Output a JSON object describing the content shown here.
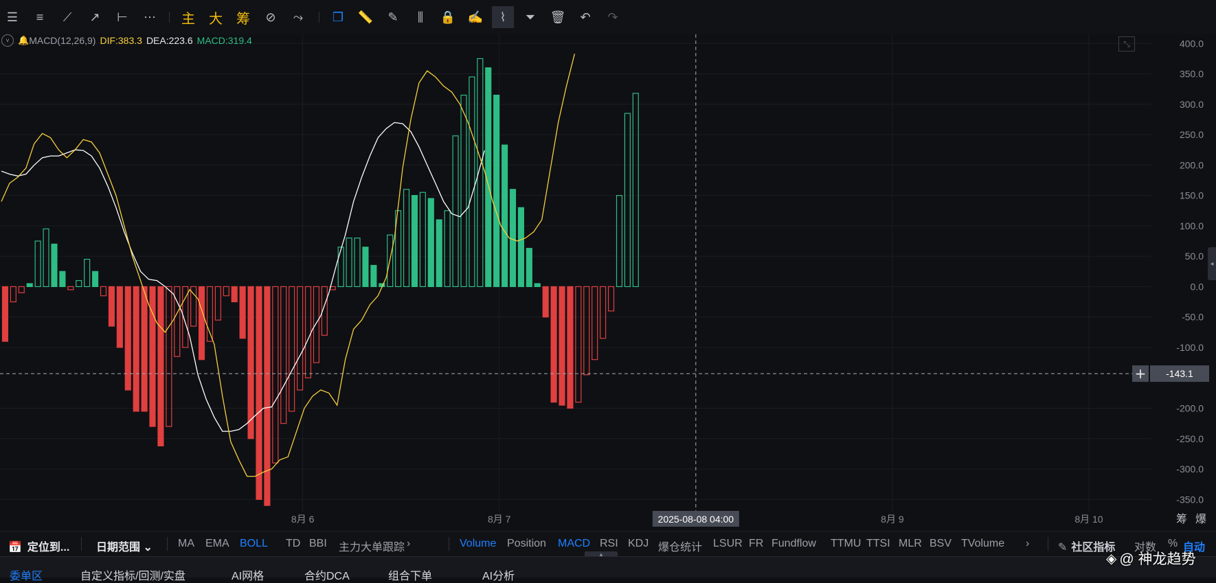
{
  "toolbar": {
    "tools": [
      {
        "icon": "menu-icon",
        "glyph": "☰"
      },
      {
        "icon": "horizontal-lines-icon",
        "glyph": "≡"
      },
      {
        "icon": "trend-line-icon",
        "glyph": "⟋"
      },
      {
        "icon": "ray-line-icon",
        "glyph": "↗"
      },
      {
        "icon": "horizontal-line-icon",
        "glyph": "⊢"
      },
      {
        "icon": "more-tools-icon",
        "glyph": "⋯"
      }
    ],
    "chip_labels": [
      "主",
      "大",
      "筹"
    ],
    "tools2": [
      {
        "icon": "formula-edit-icon",
        "glyph": "⊘"
      },
      {
        "icon": "signal-edit-icon",
        "glyph": "⤳"
      }
    ],
    "tools3": [
      {
        "icon": "copy-layer-icon",
        "glyph": "❐",
        "state": "blue"
      },
      {
        "icon": "ruler-icon",
        "glyph": "📏"
      },
      {
        "icon": "pen-icon",
        "glyph": "✎"
      },
      {
        "icon": "candlestick-icon",
        "glyph": "⫼"
      },
      {
        "icon": "lock-icon",
        "glyph": "🔒"
      },
      {
        "icon": "note-edit-icon",
        "glyph": "✍"
      },
      {
        "icon": "magnet-icon",
        "glyph": "⌇",
        "state": "active"
      },
      {
        "icon": "filter-icon",
        "glyph": "⏷"
      },
      {
        "icon": "trash-icon",
        "glyph": "🗑"
      },
      {
        "icon": "undo-icon",
        "glyph": "↶"
      },
      {
        "icon": "redo-icon",
        "glyph": "↷",
        "state": "dim"
      }
    ]
  },
  "legend": {
    "indicator": "MACD(12,26,9)",
    "dif": "DIF:383.3",
    "dea": "DEA:223.6",
    "macd": "MACD:319.4"
  },
  "crosshair": {
    "price_label": "-143.1",
    "time_label": "2025-08-08 04:00"
  },
  "right_axis_extra": [
    "筹",
    "爆"
  ],
  "colors": {
    "background": "#0f1014",
    "up": "#2ebd85",
    "down": "#e0403f",
    "dif_line": "#f7cf3c",
    "dea_line": "#ffffff",
    "accent": "#1e80ff"
  },
  "chart_data": {
    "type": "bar",
    "title": "MACD(12,26,9)",
    "ylim": [
      -370,
      415
    ],
    "yticks": [
      400,
      350,
      300,
      250,
      200,
      150,
      100,
      50,
      0,
      -50,
      -100,
      -200,
      -250,
      -300,
      -350
    ],
    "ytick_labels": [
      "400.0",
      "350.0",
      "300.0",
      "250.0",
      "200.0",
      "150.0",
      "100.0",
      "50.0",
      "0.0",
      "-50.0",
      "-100.0",
      "-200.0",
      "-250.0",
      "-300.0",
      "-350.0"
    ],
    "x_tick_labels": [
      {
        "label": "8月 6",
        "bar": 36.8
      },
      {
        "label": "8月 7",
        "bar": 60.8
      },
      {
        "label": "8月 9",
        "bar": 108.8
      },
      {
        "label": "8月 10",
        "bar": 132.8
      }
    ],
    "crosshair_bar": 84.8,
    "crosshair_value": -143.1,
    "bar_step_hours": 1,
    "histogram": [
      -90,
      -25,
      -10,
      5,
      75,
      95,
      70,
      25,
      -5,
      10,
      45,
      25,
      -15,
      -65,
      -100,
      -170,
      -205,
      -205,
      -230,
      -262,
      -230,
      -115,
      -100,
      -65,
      -120,
      -90,
      -55,
      -15,
      -25,
      -85,
      -250,
      -350,
      -360,
      -290,
      -225,
      -205,
      -170,
      -150,
      -125,
      -80,
      -5,
      65,
      80,
      80,
      65,
      35,
      5,
      85,
      125,
      160,
      150,
      155,
      145,
      110,
      125,
      248,
      315,
      345,
      375,
      360,
      315,
      233,
      160,
      130,
      63,
      5,
      -50,
      -190,
      -195,
      -200,
      -190,
      -145,
      -120,
      -85,
      -40,
      150,
      285,
      318
    ],
    "dif": [
      140,
      170,
      180,
      195,
      235,
      252,
      245,
      225,
      212,
      225,
      242,
      238,
      220,
      185,
      150,
      100,
      50,
      10,
      -30,
      -60,
      -75,
      -55,
      -30,
      -5,
      -20,
      -60,
      -95,
      -180,
      -255,
      -285,
      -312,
      -312,
      -305,
      -300,
      -285,
      -280,
      -240,
      -200,
      -180,
      -170,
      -175,
      -195,
      -120,
      -70,
      -55,
      -30,
      -15,
      15,
      80,
      195,
      275,
      335,
      355,
      345,
      330,
      320,
      300,
      270,
      230,
      190,
      140,
      100,
      80,
      75,
      80,
      90,
      110,
      190,
      270,
      330,
      383
    ],
    "dea": [
      190,
      185,
      182,
      185,
      200,
      212,
      215,
      215,
      220,
      225,
      224,
      215,
      195,
      165,
      130,
      90,
      55,
      25,
      12,
      10,
      0,
      -12,
      -40,
      -82,
      -145,
      -185,
      -215,
      -238,
      -238,
      -235,
      -225,
      -212,
      -200,
      -198,
      -175,
      -150,
      -125,
      -100,
      -70,
      -48,
      -10,
      40,
      85,
      140,
      180,
      215,
      245,
      260,
      270,
      268,
      255,
      230,
      200,
      170,
      140,
      120,
      115,
      130,
      175,
      224
    ]
  },
  "bottom_bar": {
    "locate": "定位到...",
    "date_range": "日期范围",
    "main_indicators": [
      "MA",
      "EMA",
      "BOLL",
      "TD",
      "BBI",
      "主力大单跟踪"
    ],
    "main_active": "BOLL",
    "sub_indicators": [
      "Volume",
      "Position",
      "MACD",
      "RSI",
      "KDJ",
      "爆仓统计",
      "LSUR",
      "FR",
      "Fundflow",
      "TTMU",
      "TTSI",
      "MLR",
      "BSV",
      "TVolume"
    ],
    "sub_active": [
      "Volume",
      "MACD"
    ],
    "community": "社区指标",
    "log": "对数",
    "percent": "%",
    "auto": "自动"
  },
  "panel_tabs": [
    "委单区",
    "自定义指标/回测/实盘",
    "AI网格",
    "合约DCA",
    "组合下单",
    "AI分析"
  ],
  "watermark": "@ 神龙趋势"
}
